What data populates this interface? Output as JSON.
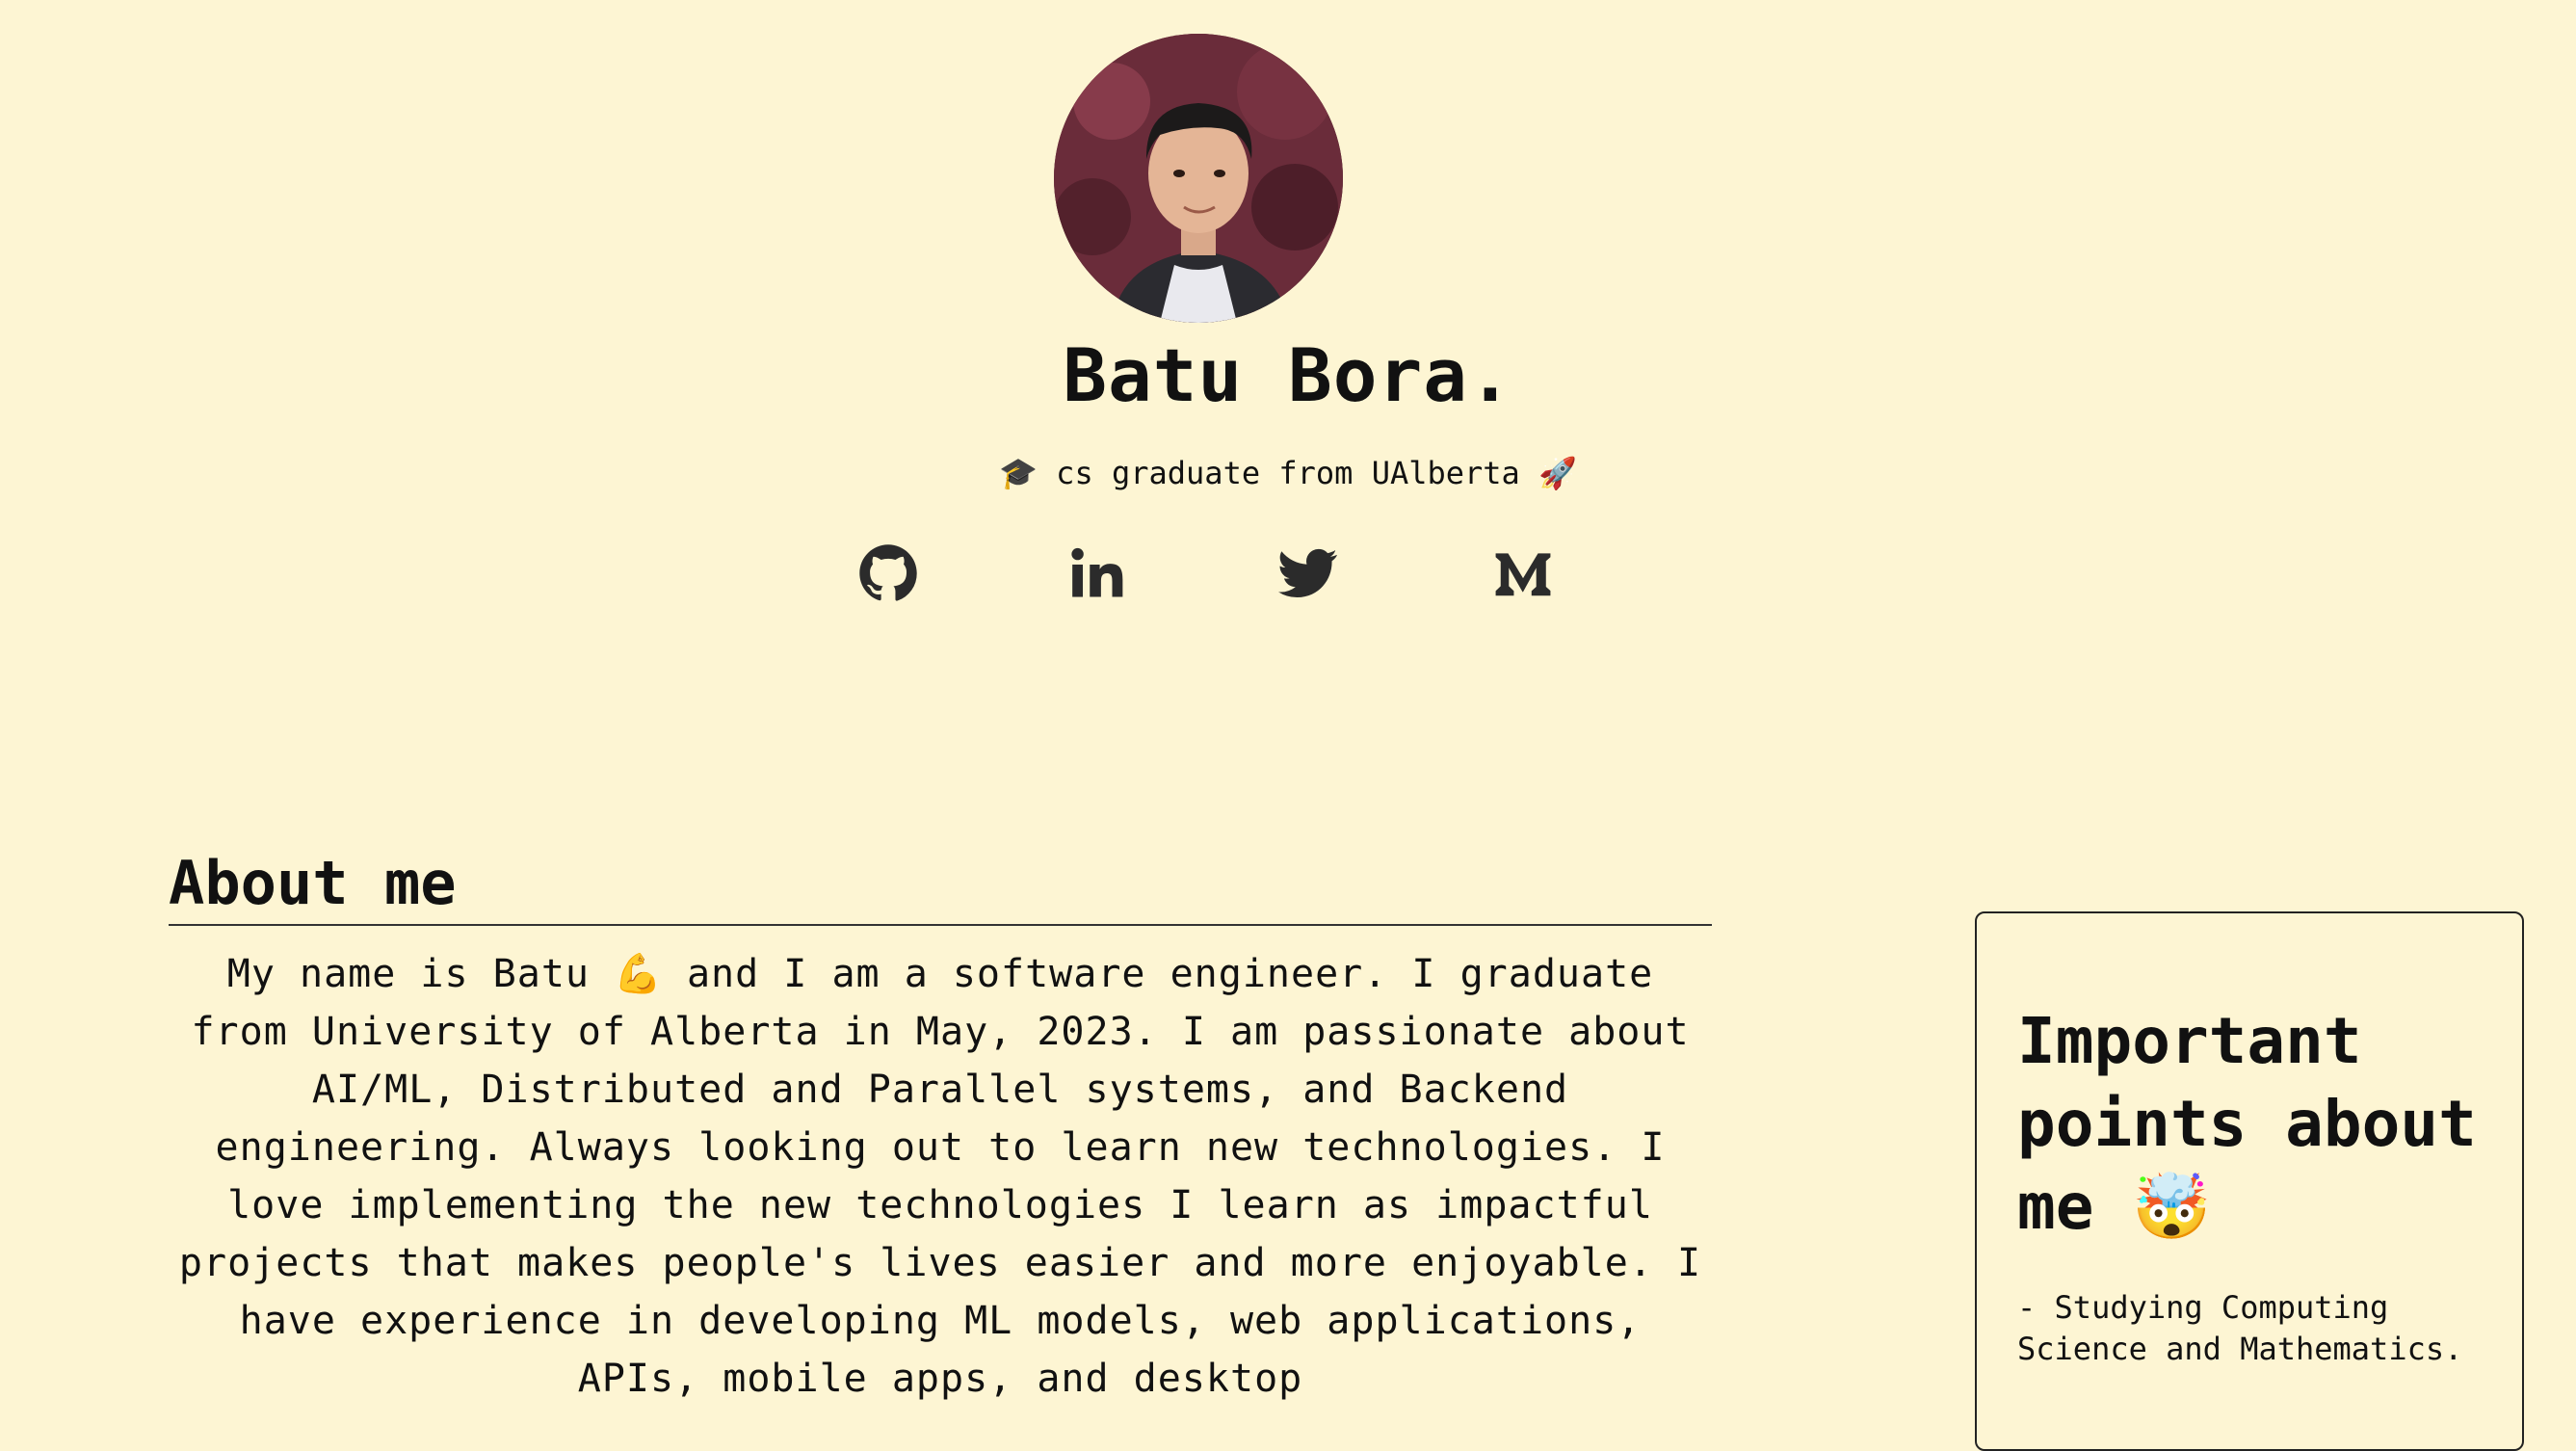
{
  "profile": {
    "name": "Batu Bora.",
    "tagline": "🎓 cs graduate from UAlberta 🚀",
    "avatar_alt": "profile-photo"
  },
  "socials": [
    {
      "icon": "github-icon"
    },
    {
      "icon": "linkedin-icon"
    },
    {
      "icon": "twitter-icon"
    },
    {
      "icon": "medium-icon"
    }
  ],
  "about": {
    "title": "About me",
    "text": "My name is Batu 💪 and I am a software engineer. I graduate from University of Alberta in May, 2023. I am passionate about AI/ML, Distributed and Parallel systems, and Backend engineering. Always looking out to learn new technologies. I love implementing the new technologies I learn as impactful projects that makes people's lives easier and more enjoyable. I have experience in developing ML models, web applications, APIs, mobile apps, and desktop"
  },
  "important": {
    "title": "Important points about me 🤯",
    "points": [
      "- Studying Computing Science and Mathematics."
    ]
  },
  "colors": {
    "background": "#fdf5d3",
    "text": "#111111",
    "icon": "#2b2b2b"
  }
}
